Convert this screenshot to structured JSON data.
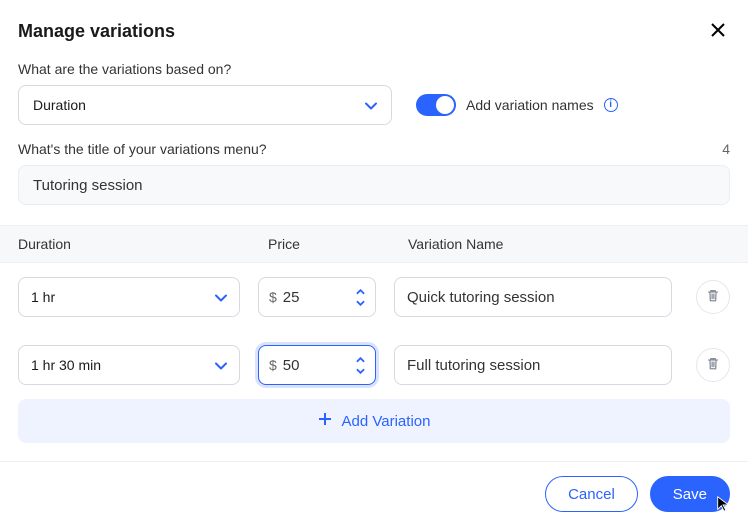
{
  "title": "Manage variations",
  "q1_label": "What are the variations based on?",
  "basis_select": {
    "value": "Duration"
  },
  "toggle_label": "Add variation names",
  "q2_label": "What's the title of your variations menu?",
  "title_counter": "4",
  "menu_title_value": "Tutoring session",
  "columns": {
    "duration": "Duration",
    "price": "Price",
    "name": "Variation Name"
  },
  "currency_symbol": "$",
  "variations": [
    {
      "duration": "1 hr",
      "price": "25",
      "name": "Quick tutoring session",
      "price_focused": false
    },
    {
      "duration": "1 hr 30 min",
      "price": "50",
      "name": "Full tutoring session",
      "price_focused": true
    }
  ],
  "add_variation_label": "Add Variation",
  "buttons": {
    "cancel": "Cancel",
    "save": "Save"
  }
}
